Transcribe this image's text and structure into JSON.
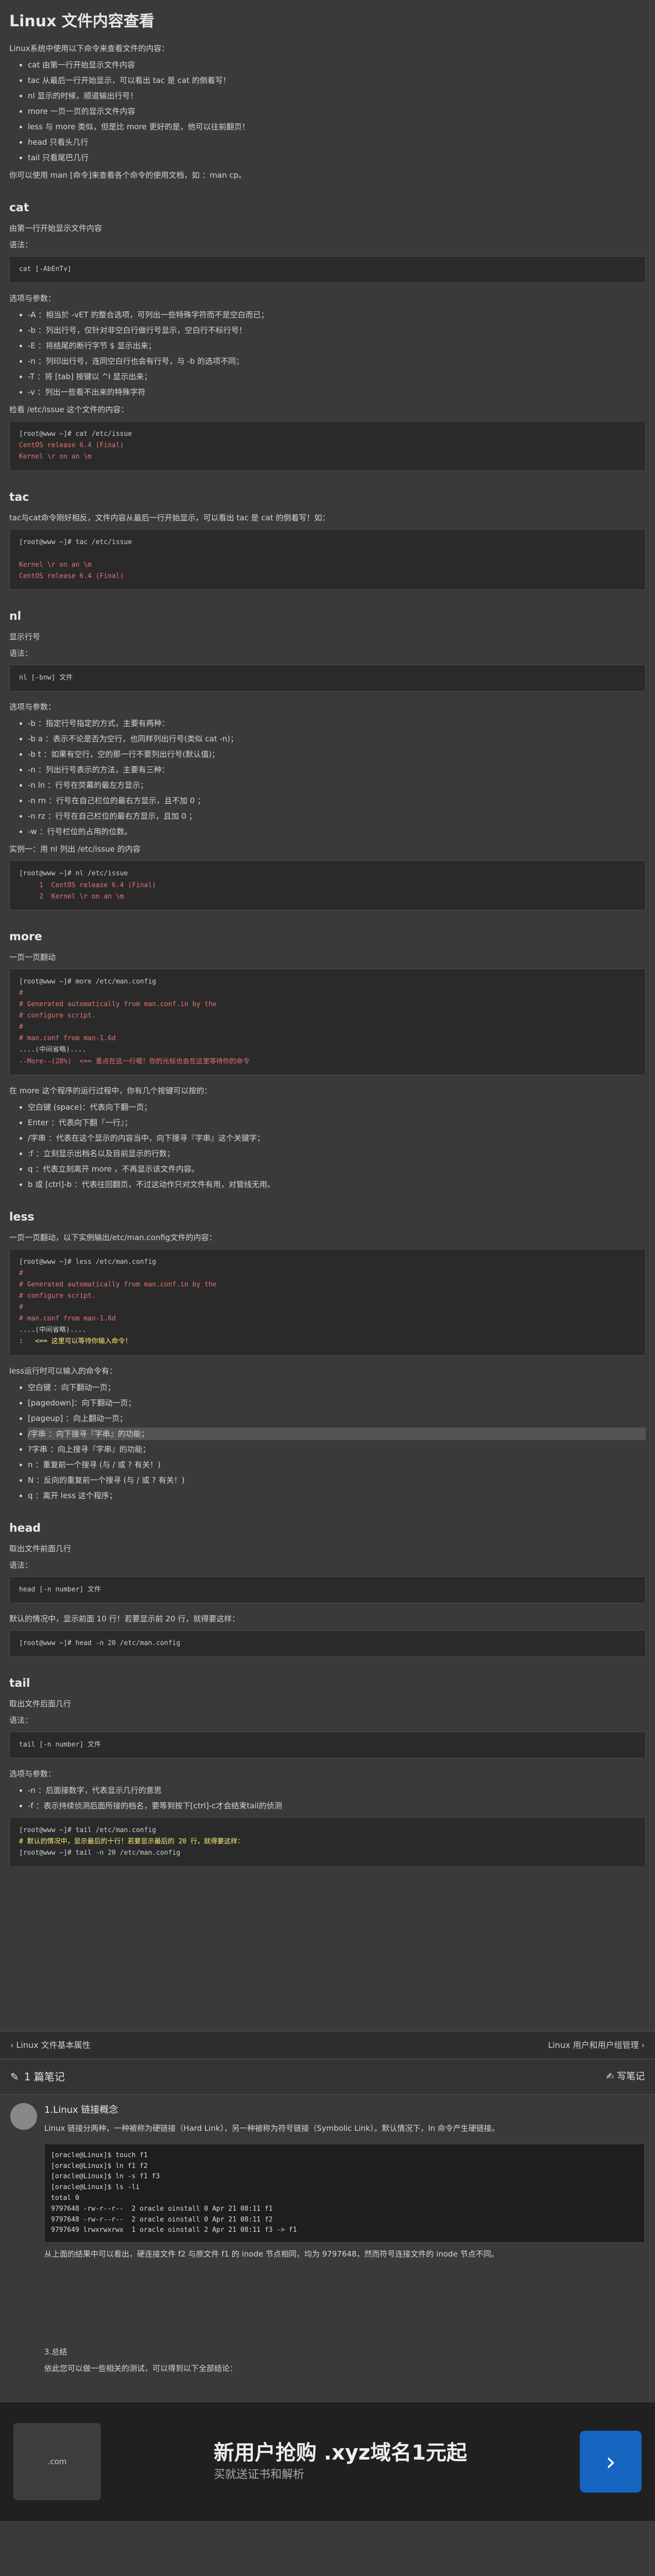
{
  "title": "Linux 文件内容查看",
  "intro": "Linux系统中使用以下命令来查看文件的内容：",
  "cmds": [
    "cat 由第一行开始显示文件内容",
    "tac 从最后一行开始显示，可以看出 tac 是 cat 的倒着写！",
    "nl 显示的时候，顺道输出行号！",
    "more 一页一页的显示文件内容",
    "less 与 more 类似，但是比 more 更好的是，他可以往前翻页！",
    "head 只看头几行",
    "tail 只看尾巴几行"
  ],
  "man_tip": "你可以使用 man [命令]来查看各个命令的使用文档，如 ：man cp。",
  "cat": {
    "h": "cat",
    "p1": "由第一行开始显示文件内容",
    "syntax_label": "语法：",
    "syntax": "cat [-AbEnTv]",
    "opts_label": "选项与参数：",
    "opts": [
      "-A ：相当於 -vET 的整合选项，可列出一些特殊字符而不是空白而已；",
      "-b ：列出行号，仅针对非空白行做行号显示，空白行不标行号！",
      "-E ：将结尾的断行字节 $ 显示出来；",
      "-n ：列印出行号，连同空白行也会有行号，与 -b 的选项不同；",
      "-T ：将 [tab] 按键以 ^I 显示出来；",
      "-v ：列出一些看不出来的特殊字符"
    ],
    "example_label": "检看 /etc/issue 这个文件的内容：",
    "code1": "[root@www ~]# cat /etc/issue",
    "code2": "CentOS release 6.4 (Final)",
    "code3": "Kernel \\r on an \\m"
  },
  "tac": {
    "h": "tac",
    "p1": "tac与cat命令刚好相反，文件内容从最后一行开始显示，可以看出 tac 是 cat 的倒着写！如：",
    "code1": "[root@www ~]# tac /etc/issue",
    "code2": "Kernel \\r on an \\m",
    "code3": "CentOS release 6.4 (Final)"
  },
  "nl": {
    "h": "nl",
    "p1": "显示行号",
    "syntax_label": "语法：",
    "syntax": "nl [-bnw] 文件",
    "opts_label": "选项与参数：",
    "opts": [
      "-b ：指定行号指定的方式，主要有两种：",
      "-b a ：表示不论是否为空行，也同样列出行号(类似 cat -n)；",
      "-b t ：如果有空行，空的那一行不要列出行号(默认值)；",
      "-n ：列出行号表示的方法，主要有三种：",
      "-n ln ：行号在荧幕的最左方显示；",
      "-n rn ：行号在自己栏位的最右方显示，且不加 0 ；",
      "-n rz ：行号在自己栏位的最右方显示，且加 0 ；",
      "-w ：行号栏位的占用的位数。"
    ],
    "example_label": "实例一：用 nl 列出 /etc/issue 的内容",
    "code1": "[root@www ~]# nl /etc/issue",
    "code2": "     1  CentOS release 6.4 (Final)",
    "code3": "     2  Kernel \\r on an \\m"
  },
  "more": {
    "h": "more",
    "p1": "一页一页翻动",
    "code1": "[root@www ~]# more /etc/man.config",
    "code2": "#",
    "code3": "# Generated automatically from man.conf.in by the",
    "code4": "# configure script.",
    "code5": "#",
    "code6": "# man.conf from man-1.6d",
    "code7": "....(中间省略)....",
    "code8": "--More--(28%)  <== 重点在这一行喔！你的光标也会在这里等待你的命令",
    "p2": "在 more 这个程序的运行过程中，你有几个按键可以按的：",
    "keys": [
      "空白键 (space)：代表向下翻一页；",
      "Enter ：代表向下翻『一行』；",
      "/字串 ：代表在这个显示的内容当中，向下搜寻『字串』这个关键字；",
      ":f ：立刻显示出档名以及目前显示的行数；",
      "q ：代表立刻离开 more ，不再显示该文件内容。",
      "b 或 [ctrl]-b ：代表往回翻页，不过这动作只对文件有用，对管线无用。"
    ]
  },
  "less": {
    "h": "less",
    "p1": "一页一页翻动，以下实例输出/etc/man.config文件的内容：",
    "code1": "[root@www ~]# less /etc/man.config",
    "code2": "#",
    "code3": "# Generated automatically from man.conf.in by the",
    "code4": "# configure script.",
    "code5": "#",
    "code6": "# man.conf from man-1.6d",
    "code7": "....(中间省略)....",
    "code8": ":   <== 这里可以等待你输入命令！",
    "p2": "less运行时可以输入的命令有：",
    "keys": [
      "空白键 ：向下翻动一页；",
      "[pagedown]：向下翻动一页；",
      "[pageup] ：向上翻动一页；",
      "/字串 ：向下搜寻『字串』的功能；",
      "?字串 ：向上搜寻『字串』的功能；",
      "n ：重复前一个搜寻 (与 / 或 ? 有关！)",
      "N ：反向的重复前一个搜寻 (与 / 或 ? 有关！)",
      "q ：离开 less 这个程序；"
    ]
  },
  "head": {
    "h": "head",
    "p1": "取出文件前面几行",
    "syntax_label": "语法：",
    "syntax": "head [-n number] 文件",
    "p2": "默认的情况中，显示前面 10 行！若要显示前 20 行，就得要这样：",
    "code1": "[root@www ~]# head -n 20 /etc/man.config"
  },
  "tail": {
    "h": "tail",
    "p1": "取出文件后面几行",
    "syntax_label": "语法：",
    "syntax": "tail [-n number] 文件",
    "opts_label": "选项与参数：",
    "opts": [
      "-n ：后面接数字，代表显示几行的意思",
      "-f ：表示持续侦测后面所接的档名，要等到按下[ctrl]-c才会结束tail的侦测"
    ],
    "code1": "[root@www ~]# tail /etc/man.config",
    "code2": "# 默认的情况中，显示最后的十行！若要显示最后的 20 行，就得要这样：",
    "code3": "[root@www ~]# tail -n 20 /etc/man.config"
  },
  "nav": {
    "prev": "Linux 文件基本属性",
    "next": "Linux 用户和用户组管理"
  },
  "notes": {
    "count_label": "1 篇笔记",
    "write_label": "写笔记",
    "title": "1.Linux 链接概念",
    "p1": "Linux 链接分两种，一种被称为硬链接（Hard Link），另一种被称为符号链接（Symbolic Link）。默认情况下，ln 命令产生硬链接。",
    "code": "[oracle@Linux]$ touch f1\n[oracle@Linux]$ ln f1 f2\n[oracle@Linux]$ ln -s f1 f3\n[oracle@Linux]$ ls -li\ntotal 0\n9797648 -rw-r--r--  2 oracle oinstall 0 Apr 21 08:11 f1\n9797648 -rw-r--r--  2 oracle oinstall 0 Apr 21 08:11 f2\n9797649 lrwxrwxrwx  1 oracle oinstall 2 Apr 21 08:11 f3 -> f1",
    "p2": "从上面的结果中可以看出，硬连接文件 f2 与原文件 f1 的 inode 节点相同，均为 9797648，然而符号连接文件的 inode 节点不同。",
    "sum_label": "3.总结",
    "sum": "依此您可以做一些相关的测试，可以得到以下全部结论："
  },
  "banner": {
    "logo": ".com",
    "cta": "新用户抢购 .xyz域名1元起",
    "sub": "买就送证书和解析",
    "go": "›"
  }
}
